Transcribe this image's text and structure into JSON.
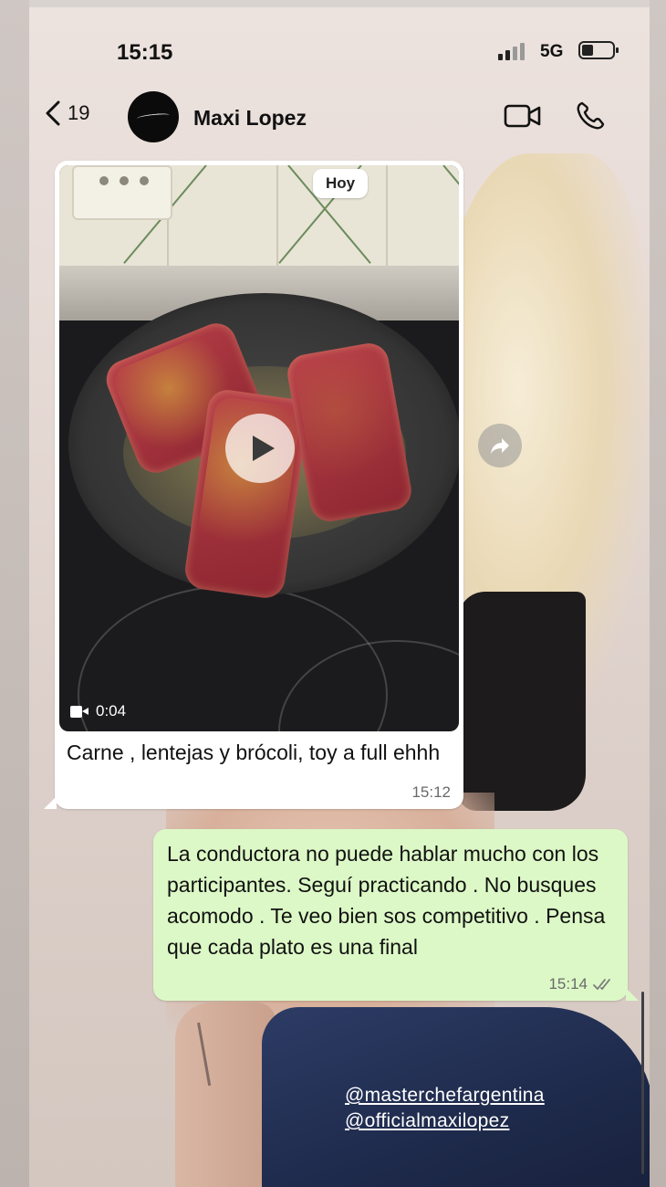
{
  "status_bar": {
    "time": "15:15",
    "network": "5G"
  },
  "header": {
    "unread_count": "19",
    "contact_name": "Maxi Lopez",
    "icons": [
      "back-chevron-icon",
      "avatar",
      "video-call-icon",
      "phone-icon"
    ]
  },
  "messages": {
    "incoming": {
      "date_chip": "Hoy",
      "video_duration": "0:04",
      "caption": "Carne , lentejas y brócoli, toy a full ehhh",
      "time": "15:12"
    },
    "outgoing": {
      "text": "La conductora no puede hablar mucho con los participantes. Seguí practicando . No busques acomodo . Te veo bien sos competitivo . Pensa que cada plato es una final",
      "time": "15:14",
      "status": "read"
    }
  },
  "mentions": [
    "@masterchefargentina",
    "@officialmaxilopez"
  ],
  "colors": {
    "outgoing_bubble": "#dcf8c6",
    "incoming_bubble": "#ffffff",
    "text": "#111111",
    "meta": "#6a6a6a"
  }
}
